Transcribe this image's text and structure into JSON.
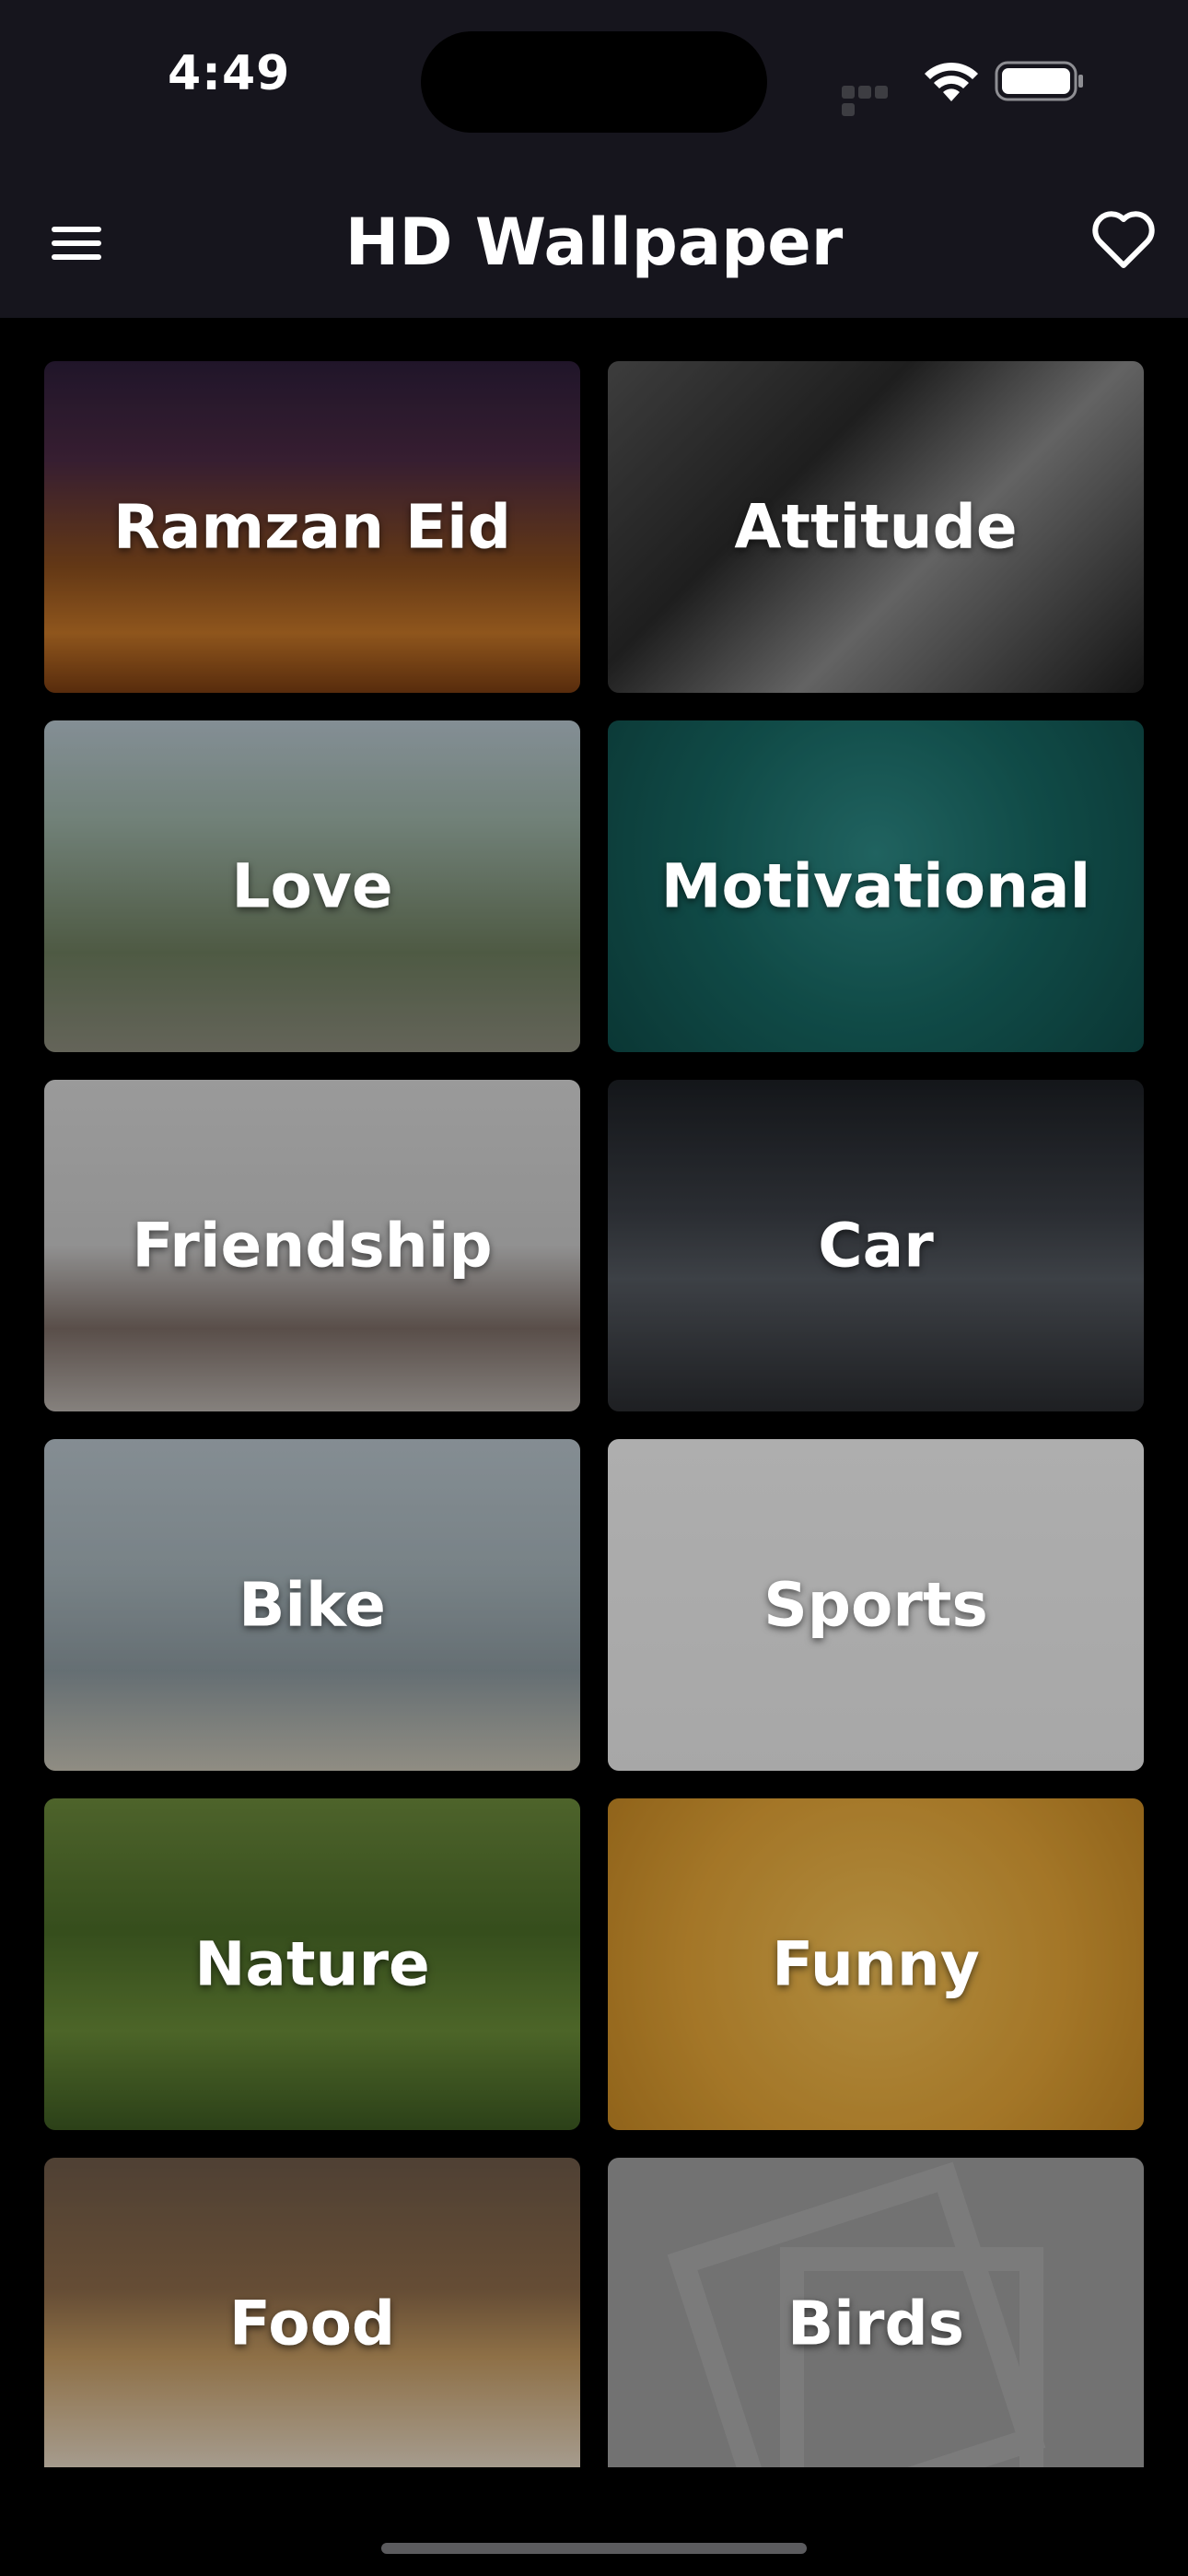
{
  "status_bar": {
    "time": "4:49",
    "icons": [
      "cellular-signal-icon",
      "wifi-icon",
      "battery-icon"
    ]
  },
  "app_bar": {
    "title": "HD Wallpaper",
    "menu_icon": "hamburger-menu-icon",
    "favorite_icon": "heart-outline-icon"
  },
  "categories": [
    {
      "label": "Ramzan Eid"
    },
    {
      "label": "Attitude"
    },
    {
      "label": "Love"
    },
    {
      "label": "Motivational"
    },
    {
      "label": "Friendship"
    },
    {
      "label": "Car"
    },
    {
      "label": "Bike"
    },
    {
      "label": "Sports"
    },
    {
      "label": "Nature"
    },
    {
      "label": "Funny"
    },
    {
      "label": "Food"
    },
    {
      "label": "Birds"
    }
  ],
  "colors": {
    "background": "#000000",
    "app_bar": "#16151d",
    "text": "#ffffff"
  }
}
